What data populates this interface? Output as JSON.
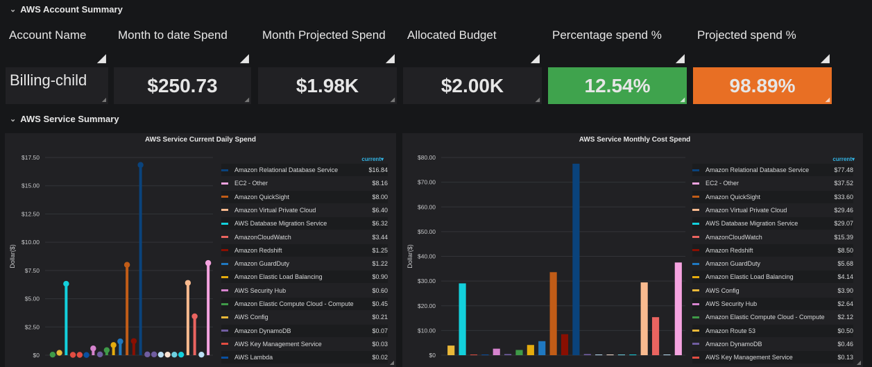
{
  "account_section": {
    "title": "AWS Account Summary",
    "columns": [
      "Account Name",
      "Month to date Spend",
      "Month Projected Spend",
      "Allocated Budget",
      "Percentage spend %",
      "Projected spend %"
    ],
    "values": [
      "Billing-child",
      "$250.73",
      "$1.98K",
      "$2.00K",
      "12.54%",
      "98.89%"
    ],
    "colors": {
      "percentage": "#3fa34d",
      "projected": "#e86f24"
    }
  },
  "service_section": {
    "title": "AWS Service Summary"
  },
  "chart_data": [
    {
      "type": "bar",
      "title": "AWS Service Current Daily Spend",
      "ylabel": "Dollar($)",
      "ylim": [
        0,
        17.5
      ],
      "yticks": [
        "$0",
        "$2.50",
        "$5.00",
        "$7.50",
        "$10.00",
        "$12.50",
        "$15.00",
        "$17.50"
      ],
      "legend_header": "current▾",
      "legend": [
        {
          "name": "Amazon Relational Database Service",
          "value": "$16.84",
          "color": "#0a437c"
        },
        {
          "name": "EC2 - Other",
          "value": "$8.16",
          "color": "#f5a3e0"
        },
        {
          "name": "Amazon QuickSight",
          "value": "$8.00",
          "color": "#c15c17"
        },
        {
          "name": "Amazon Virtual Private Cloud",
          "value": "$6.40",
          "color": "#f9ba8f"
        },
        {
          "name": "AWS Database Migration Service",
          "value": "$6.32",
          "color": "#13d0dc"
        },
        {
          "name": "AmazonCloudWatch",
          "value": "$3.44",
          "color": "#ea6460"
        },
        {
          "name": "Amazon Redshift",
          "value": "$1.25",
          "color": "#890f02"
        },
        {
          "name": "Amazon GuardDuty",
          "value": "$1.22",
          "color": "#1f78c1"
        },
        {
          "name": "Amazon Elastic Load Balancing",
          "value": "$0.90",
          "color": "#e5ac0e"
        },
        {
          "name": "AWS Security Hub",
          "value": "$0.60",
          "color": "#d683ce"
        },
        {
          "name": "Amazon Elastic Compute Cloud - Compute",
          "value": "$0.45",
          "color": "#3f9a48"
        },
        {
          "name": "AWS Config",
          "value": "$0.21",
          "color": "#eab839"
        },
        {
          "name": "Amazon DynamoDB",
          "value": "$0.07",
          "color": "#705da0"
        },
        {
          "name": "AWS Key Management Service",
          "value": "$0.03",
          "color": "#e24d42"
        },
        {
          "name": "AWS Lambda",
          "value": "$0.02",
          "color": "#0a50a1"
        }
      ],
      "bars": [
        {
          "value": 0.05,
          "color": "#3f9a48"
        },
        {
          "value": 0.21,
          "color": "#eab839"
        },
        {
          "value": 6.32,
          "color": "#13d0dc"
        },
        {
          "value": 0.03,
          "color": "#e24d42"
        },
        {
          "value": 0.03,
          "color": "#e24d42"
        },
        {
          "value": 0.02,
          "color": "#0a50a1"
        },
        {
          "value": 0.6,
          "color": "#d683ce"
        },
        {
          "value": 0.07,
          "color": "#705da0"
        },
        {
          "value": 0.45,
          "color": "#3f9a48"
        },
        {
          "value": 0.9,
          "color": "#e5ac0e"
        },
        {
          "value": 1.22,
          "color": "#1f78c1"
        },
        {
          "value": 8.0,
          "color": "#c15c17"
        },
        {
          "value": 1.25,
          "color": "#890f02"
        },
        {
          "value": 16.84,
          "color": "#0a437c"
        },
        {
          "value": 0.07,
          "color": "#705da0"
        },
        {
          "value": 0.07,
          "color": "#705da0"
        },
        {
          "value": 0.05,
          "color": "#badff4"
        },
        {
          "value": 0.05,
          "color": "#f9e2d2"
        },
        {
          "value": 0.05,
          "color": "#6ed0e0"
        },
        {
          "value": 0.05,
          "color": "#13d0dc"
        },
        {
          "value": 6.4,
          "color": "#f9ba8f"
        },
        {
          "value": 3.44,
          "color": "#ea6460"
        },
        {
          "value": 0.05,
          "color": "#badff4"
        },
        {
          "value": 8.16,
          "color": "#f5a3e0"
        }
      ]
    },
    {
      "type": "bar",
      "title": "AWS Service Monthly Cost Spend",
      "ylabel": "Dollar($)",
      "ylim": [
        0,
        80
      ],
      "yticks": [
        "$0",
        "$10.00",
        "$20.00",
        "$30.00",
        "$40.00",
        "$50.00",
        "$60.00",
        "$70.00",
        "$80.00"
      ],
      "legend_header": "current▾",
      "legend": [
        {
          "name": "Amazon Relational Database Service",
          "value": "$77.48",
          "color": "#0a437c"
        },
        {
          "name": "EC2 - Other",
          "value": "$37.52",
          "color": "#f5a3e0"
        },
        {
          "name": "Amazon QuickSight",
          "value": "$33.60",
          "color": "#c15c17"
        },
        {
          "name": "Amazon Virtual Private Cloud",
          "value": "$29.46",
          "color": "#f9ba8f"
        },
        {
          "name": "AWS Database Migration Service",
          "value": "$29.07",
          "color": "#13d0dc"
        },
        {
          "name": "AmazonCloudWatch",
          "value": "$15.39",
          "color": "#ea6460"
        },
        {
          "name": "Amazon Redshift",
          "value": "$8.50",
          "color": "#890f02"
        },
        {
          "name": "Amazon GuardDuty",
          "value": "$5.68",
          "color": "#1f78c1"
        },
        {
          "name": "Amazon Elastic Load Balancing",
          "value": "$4.14",
          "color": "#e5ac0e"
        },
        {
          "name": "AWS Config",
          "value": "$3.90",
          "color": "#eab839"
        },
        {
          "name": "AWS Security Hub",
          "value": "$2.64",
          "color": "#d683ce"
        },
        {
          "name": "Amazon Elastic Compute Cloud - Compute",
          "value": "$2.12",
          "color": "#3f9a48"
        },
        {
          "name": "Amazon Route 53",
          "value": "$0.50",
          "color": "#eab839"
        },
        {
          "name": "Amazon DynamoDB",
          "value": "$0.46",
          "color": "#705da0"
        },
        {
          "name": "AWS Key Management Service",
          "value": "$0.13",
          "color": "#e24d42"
        }
      ],
      "bars": [
        {
          "value": 3.9,
          "color": "#eab839"
        },
        {
          "value": 29.07,
          "color": "#13d0dc"
        },
        {
          "value": 0.13,
          "color": "#e24d42"
        },
        {
          "value": 0.1,
          "color": "#0a50a1"
        },
        {
          "value": 2.64,
          "color": "#d683ce"
        },
        {
          "value": 0.46,
          "color": "#705da0"
        },
        {
          "value": 2.12,
          "color": "#3f9a48"
        },
        {
          "value": 4.14,
          "color": "#e5ac0e"
        },
        {
          "value": 5.68,
          "color": "#1f78c1"
        },
        {
          "value": 33.6,
          "color": "#c15c17"
        },
        {
          "value": 8.5,
          "color": "#890f02"
        },
        {
          "value": 77.48,
          "color": "#0a437c"
        },
        {
          "value": 0.46,
          "color": "#705da0"
        },
        {
          "value": 0.1,
          "color": "#badff4"
        },
        {
          "value": 0.1,
          "color": "#f9e2d2"
        },
        {
          "value": 0.1,
          "color": "#6ed0e0"
        },
        {
          "value": 0.1,
          "color": "#13d0dc"
        },
        {
          "value": 29.46,
          "color": "#f9ba8f"
        },
        {
          "value": 15.39,
          "color": "#ea6460"
        },
        {
          "value": 0.1,
          "color": "#badff4"
        },
        {
          "value": 37.52,
          "color": "#f5a3e0"
        }
      ]
    }
  ]
}
